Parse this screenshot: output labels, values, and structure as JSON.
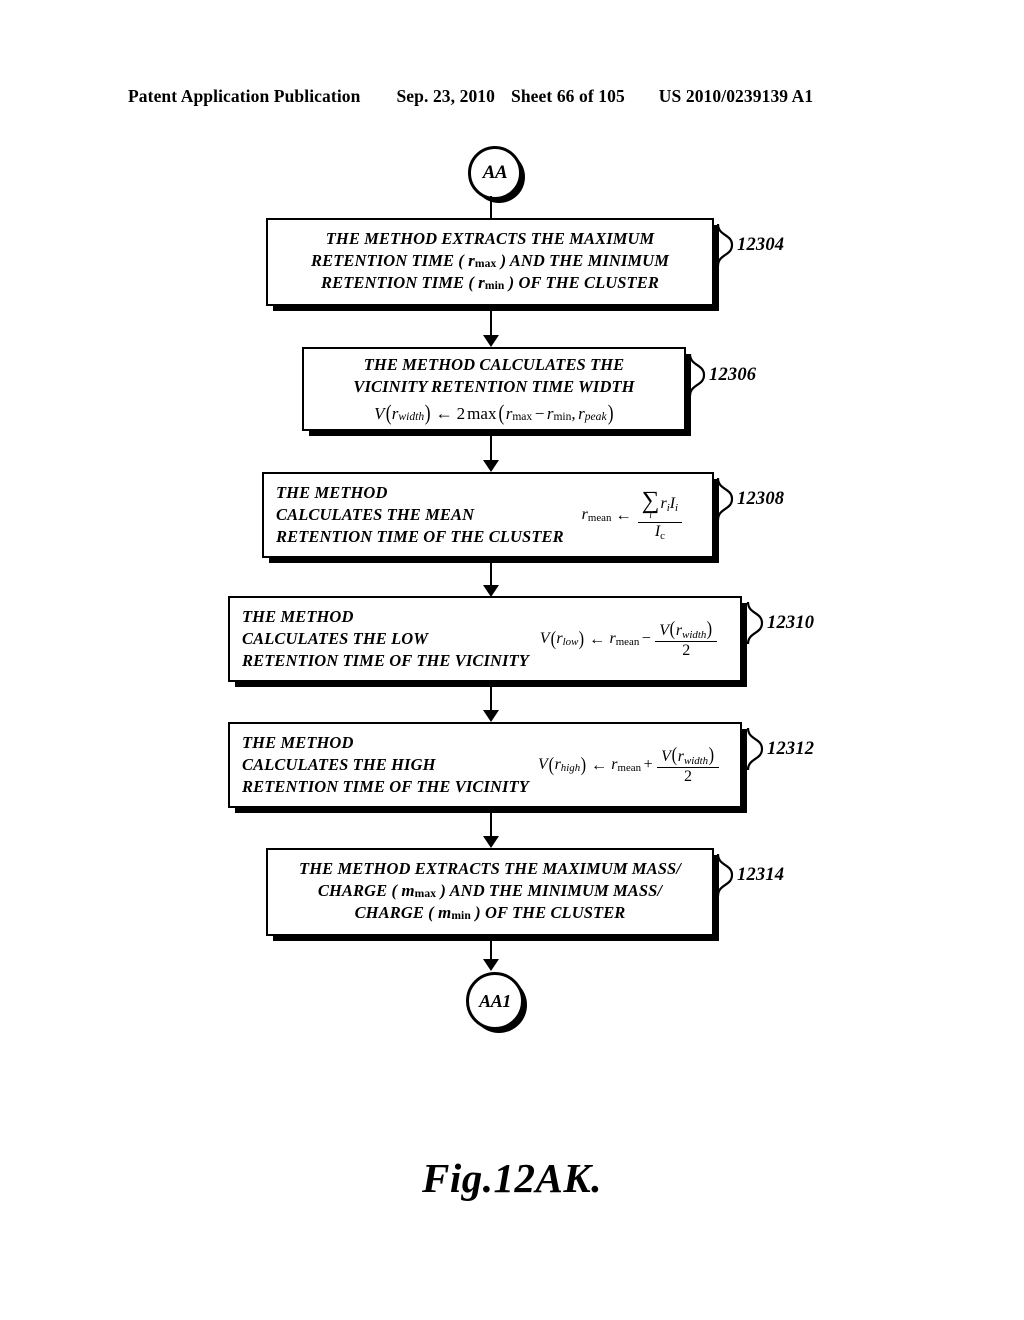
{
  "header": {
    "title": "Patent Application Publication",
    "date": "Sep. 23, 2010",
    "sheet": "Sheet 66 of 105",
    "patent_number": "US 2010/0239139 A1"
  },
  "figure": {
    "caption": "Fig.12AK."
  },
  "flow": {
    "entry_terminal": "AA",
    "exit_terminal": "AA1",
    "steps": [
      {
        "ref": "12304",
        "align": "center",
        "lines": [
          "THE METHOD EXTRACTS THE MAXIMUM",
          "RETENTION TIME (  r max   ) AND THE MINIMUM",
          "RETENTION TIME (  r min   ) OF THE CLUSTER"
        ],
        "formula": ""
      },
      {
        "ref": "12306",
        "align": "center",
        "lines": [
          "THE METHOD CALCULATES THE",
          "VICINITY RETENTION TIME WIDTH"
        ],
        "formula": "V(r_width) <- 2 max(r_max - r_min, r_peak)"
      },
      {
        "ref": "12308",
        "align": "left",
        "lines": [
          "THE METHOD",
          "CALCULATES THE MEAN",
          "RETENTION TIME OF THE CLUSTER"
        ],
        "formula": "r_mean <- (sum_i r_i I_i) / I_c"
      },
      {
        "ref": "12310",
        "align": "left",
        "lines": [
          "THE METHOD",
          "CALCULATES THE LOW",
          "RETENTION TIME OF THE VICINITY"
        ],
        "formula": "V(r_low) <- r_mean - V(r_width)/2"
      },
      {
        "ref": "12312",
        "align": "left",
        "lines": [
          "THE METHOD",
          "CALCULATES THE HIGH",
          "RETENTION TIME OF THE VICINITY"
        ],
        "formula": "V(r_high) <- r_mean + V(r_width)/2"
      },
      {
        "ref": "12314",
        "align": "center",
        "lines": [
          "THE METHOD EXTRACTS THE MAXIMUM MASS/",
          "CHARGE (  m max   ) AND THE MINIMUM MASS/",
          "CHARGE (  m min   ) OF THE CLUSTER"
        ],
        "formula": ""
      }
    ]
  },
  "symbols": {
    "V": "V",
    "r": "r",
    "m": "m",
    "I": "I",
    "two": "2",
    "sigma": "∑",
    "assign": "←",
    "minus": "−",
    "plus": "+",
    "comma": ",",
    "max": "max",
    "sub_max": "max",
    "sub_min": "min",
    "sub_width": "width",
    "sub_peak": "peak",
    "sub_mean": "mean",
    "sub_low": "low",
    "sub_high": "high",
    "sub_i": "i",
    "sub_c": "c",
    "lparen": "(",
    "rparen": ")"
  },
  "colors": {
    "ink": "#000000",
    "paper": "#ffffff"
  }
}
